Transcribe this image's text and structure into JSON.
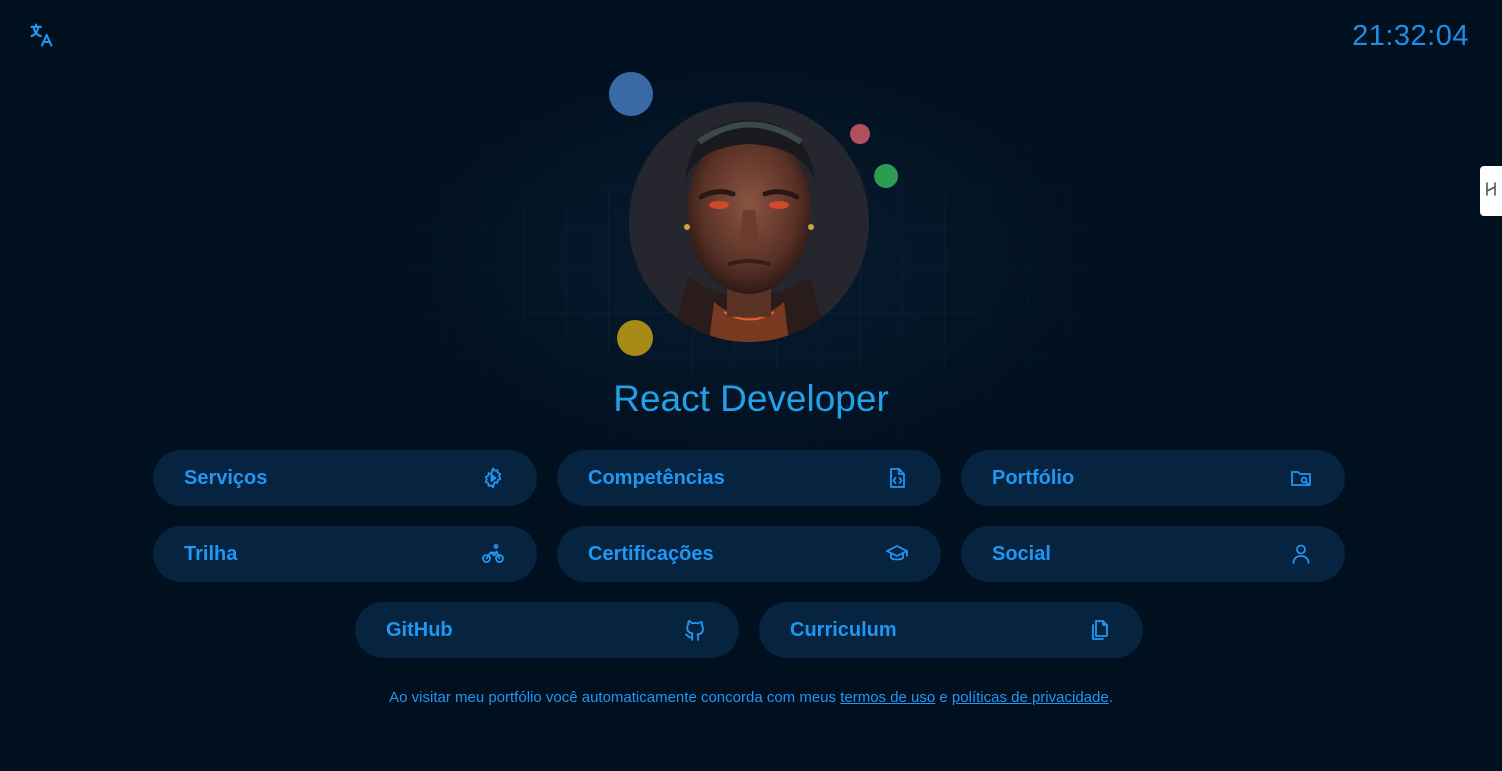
{
  "header": {
    "clock": "21:32:04",
    "translate_icon": "translate-icon",
    "side_tab_icon": "collapse-icon"
  },
  "profile": {
    "title": "React Developer",
    "avatar_alt": "avatar"
  },
  "nav": {
    "items": [
      {
        "label": "Serviços",
        "icon": "gear-play-icon"
      },
      {
        "label": "Competências",
        "icon": "code-file-icon"
      },
      {
        "label": "Portfólio",
        "icon": "folder-icon"
      },
      {
        "label": "Trilha",
        "icon": "bicycle-icon"
      },
      {
        "label": "Certificações",
        "icon": "graduation-cap-icon"
      },
      {
        "label": "Social",
        "icon": "user-icon"
      },
      {
        "label": "GitHub",
        "icon": "github-icon"
      },
      {
        "label": "Curriculum",
        "icon": "copy-document-icon"
      }
    ]
  },
  "footer": {
    "text_before": "Ao visitar meu portfólio você automaticamente concorda com meus ",
    "terms_link": "termos de uso",
    "middle": " e ",
    "privacy_link": "políticas de privacidade",
    "end": "."
  },
  "colors": {
    "background": "#01101f",
    "accent": "#2196f3",
    "button_bg": "#06233f",
    "title": "#22a0e8"
  }
}
